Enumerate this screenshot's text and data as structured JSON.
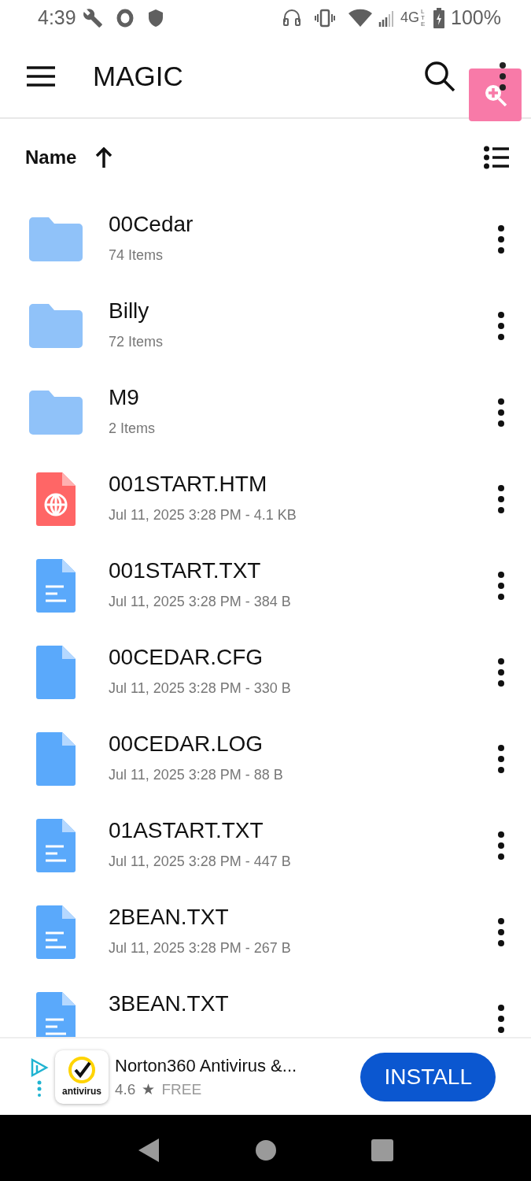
{
  "status_bar": {
    "time": "4:39",
    "network": "4G",
    "network_sub": "LTE",
    "battery": "100%"
  },
  "app_bar": {
    "title": "MAGIC"
  },
  "sort": {
    "label": "Name",
    "ascending": true
  },
  "files": [
    {
      "name": "00Cedar",
      "detail": "74 Items",
      "kind": "folder"
    },
    {
      "name": "Billy",
      "detail": "72 Items",
      "kind": "folder"
    },
    {
      "name": "M9",
      "detail": "2 Items",
      "kind": "folder"
    },
    {
      "name": "001START.HTM",
      "detail": "Jul 11, 2025 3:28 PM - 4.1 KB",
      "kind": "web"
    },
    {
      "name": "001START.TXT",
      "detail": "Jul 11, 2025 3:28 PM - 384 B",
      "kind": "text"
    },
    {
      "name": "00CEDAR.CFG",
      "detail": "Jul 11, 2025 3:28 PM - 330 B",
      "kind": "blank"
    },
    {
      "name": "00CEDAR.LOG",
      "detail": "Jul 11, 2025 3:28 PM - 88 B",
      "kind": "blank"
    },
    {
      "name": "01ASTART.TXT",
      "detail": "Jul 11, 2025 3:28 PM - 447 B",
      "kind": "text"
    },
    {
      "name": "2BEAN.TXT",
      "detail": "Jul 11, 2025 3:28 PM - 267 B",
      "kind": "text"
    },
    {
      "name": "3BEAN.TXT",
      "kind": "text"
    }
  ],
  "ad": {
    "app_icon_label": "antivirus",
    "title": "Norton360 Antivirus &...",
    "rating": "4.6",
    "star": "★",
    "price": "FREE",
    "button": "INSTALL"
  }
}
